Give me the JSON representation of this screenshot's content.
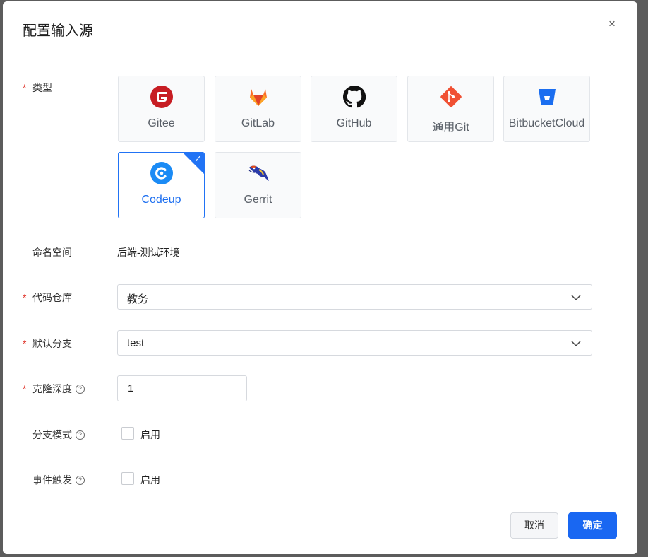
{
  "dialog": {
    "title": "配置输入源",
    "close_glyph": "×"
  },
  "form": {
    "type": {
      "label": "类型",
      "options": [
        {
          "name": "Gitee",
          "icon": "gitee-icon"
        },
        {
          "name": "GitLab",
          "icon": "gitlab-icon"
        },
        {
          "name": "GitHub",
          "icon": "github-icon"
        },
        {
          "name": "通用Git",
          "icon": "git-icon"
        },
        {
          "name": "BitbucketCloud",
          "icon": "bitbucket-icon"
        },
        {
          "name": "Codeup",
          "icon": "codeup-icon",
          "selected": true
        },
        {
          "name": "Gerrit",
          "icon": "gerrit-icon"
        }
      ]
    },
    "namespace": {
      "label": "命名空间",
      "value": "后端-测试环境"
    },
    "repo": {
      "label": "代码仓库",
      "value": "教务"
    },
    "branch": {
      "label": "默认分支",
      "value": "test"
    },
    "depth": {
      "label": "克隆深度",
      "value": "1"
    },
    "branch_mode": {
      "label": "分支模式",
      "checkbox_label": "启用",
      "checked": false
    },
    "event_trigger": {
      "label": "事件触发",
      "checkbox_label": "启用",
      "checked": false
    }
  },
  "footer": {
    "cancel_label": "取消",
    "ok_label": "确定"
  },
  "colors": {
    "primary": "#1967f2",
    "required": "#e0352b"
  }
}
